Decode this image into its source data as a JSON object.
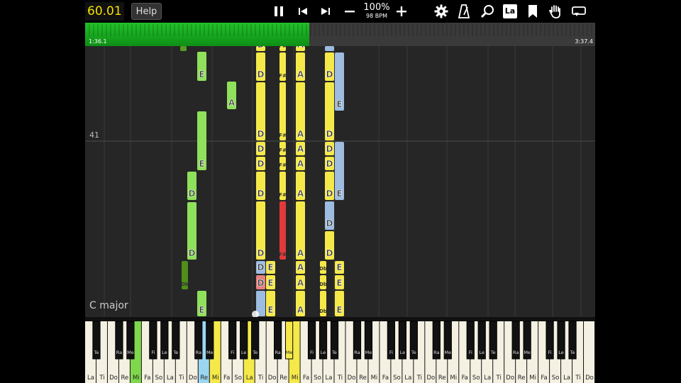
{
  "toolbar": {
    "fps": "60.01",
    "help_label": "Help",
    "tempo_percent": "100%",
    "tempo_bpm": "98 BPM",
    "icons": [
      "pause-icon",
      "rewind-icon",
      "skip-forward-icon",
      "minus-icon",
      "plus-icon",
      "gear-icon",
      "metronome-icon",
      "magnifier-icon",
      "solfege-icon",
      "bookmark-icon",
      "hand-icon",
      "loop-icon"
    ],
    "solfege_label": "La"
  },
  "timeline": {
    "elapsed": "1:36.1",
    "total": "3:37.4",
    "progress": 0.44
  },
  "roll": {
    "measure_number": "41",
    "key_signature": "C major"
  },
  "keyboard": {
    "white_labels": [
      "La",
      "Ti",
      "Do",
      "Re",
      "Mi",
      "Fa",
      "So",
      "La",
      "Ti",
      "Do",
      "Re",
      "Mi",
      "Fa",
      "So",
      "La",
      "Ti",
      "Do",
      "Re",
      "Mi",
      "Fa",
      "So",
      "La",
      "Ti",
      "Do",
      "Re",
      "Mi",
      "Fa",
      "So",
      "La",
      "Ti",
      "Do",
      "Re",
      "Mi",
      "Fa",
      "So",
      "La",
      "Ti",
      "Do",
      "Re",
      "Mi",
      "Fa",
      "So",
      "La",
      "Ti",
      "Do"
    ],
    "black_labels": [
      "Te",
      "Ra",
      "Me",
      "Fi",
      "Le",
      "Te",
      "Ra",
      "Me",
      "Fi",
      "Le",
      "Te",
      "Ra",
      "Me",
      "Fi",
      "Le",
      "Te",
      "Ra",
      "Me",
      "Fi",
      "Le",
      "Te",
      "Ra",
      "Me",
      "Fi",
      "Le",
      "Te",
      "Ra",
      "Me",
      "Fi",
      "Le",
      "Te"
    ],
    "highlighted_white": [
      {
        "index": 10,
        "color": "#9ad6f0"
      },
      {
        "index": 11,
        "color": "#f5e94a"
      },
      {
        "index": 14,
        "color": "#f5e94a"
      },
      {
        "index": 4,
        "color": "#7fd84b"
      },
      {
        "index": 18,
        "color": "#f5e94a"
      }
    ],
    "highlighted_black": [
      {
        "index": 12,
        "color": "#f5e94a"
      }
    ]
  },
  "notes": [
    {
      "label": "",
      "color": "#5a9a22",
      "lane": 134,
      "t0": 0,
      "t1": 8,
      "w": 9
    },
    {
      "label": "E",
      "color": "#8fe05a",
      "lane": 158,
      "t0": 8,
      "t1": 50,
      "w": 13
    },
    {
      "label": "A",
      "color": "#8fe05a",
      "lane": 200,
      "t0": 50,
      "t1": 90,
      "w": 13
    },
    {
      "label": "E",
      "color": "#8fe05a",
      "lane": 158,
      "t0": 92,
      "t1": 176,
      "w": 13
    },
    {
      "label": "D",
      "color": "#8fe05a",
      "lane": 144,
      "t0": 177,
      "t1": 218,
      "w": 13
    },
    {
      "label": "D",
      "color": "#8fe05a",
      "lane": 144,
      "t0": 220,
      "t1": 302,
      "w": 13
    },
    {
      "label": "Db",
      "color": "#4f8f1a",
      "lane": 136,
      "t0": 303,
      "t1": 344,
      "w": 9
    },
    {
      "label": "E",
      "color": "#8fe05a",
      "lane": 158,
      "t0": 345,
      "t1": 382,
      "w": 13
    },
    {
      "label": "D",
      "color": "#f5e94a",
      "lane": 241,
      "t0": 0,
      "t1": 8,
      "w": 13
    },
    {
      "label": "D",
      "color": "#f5e94a",
      "lane": 241,
      "t0": 9,
      "t1": 50,
      "w": 13
    },
    {
      "label": "D",
      "color": "#f5e94a",
      "lane": 241,
      "t0": 51,
      "t1": 134,
      "w": 13
    },
    {
      "label": "D",
      "color": "#f5e94a",
      "lane": 241,
      "t0": 135,
      "t1": 155,
      "w": 13
    },
    {
      "label": "D",
      "color": "#f5e94a",
      "lane": 241,
      "t0": 156,
      "t1": 176,
      "w": 13
    },
    {
      "label": "D",
      "color": "#f5e94a",
      "lane": 241,
      "t0": 177,
      "t1": 218,
      "w": 13
    },
    {
      "label": "D",
      "color": "#f5e94a",
      "lane": 241,
      "t0": 219,
      "t1": 302,
      "w": 13
    },
    {
      "label": "F#",
      "color": "#f5e94a",
      "lane": 274,
      "t0": 0,
      "t1": 8,
      "w": 9
    },
    {
      "label": "F#",
      "color": "#f5e94a",
      "lane": 274,
      "t0": 9,
      "t1": 50,
      "w": 9
    },
    {
      "label": "F#",
      "color": "#f5e94a",
      "lane": 274,
      "t0": 51,
      "t1": 134,
      "w": 9
    },
    {
      "label": "F#",
      "color": "#f5e94a",
      "lane": 274,
      "t0": 135,
      "t1": 155,
      "w": 9
    },
    {
      "label": "F#",
      "color": "#f5e94a",
      "lane": 274,
      "t0": 156,
      "t1": 176,
      "w": 9
    },
    {
      "label": "F#",
      "color": "#f5e94a",
      "lane": 274,
      "t0": 177,
      "t1": 218,
      "w": 9
    },
    {
      "label": "F#",
      "color": "#e23a3a",
      "lane": 274,
      "t0": 219,
      "t1": 302,
      "w": 9
    },
    {
      "label": "A",
      "color": "#f5e94a",
      "lane": 297,
      "t0": 0,
      "t1": 8,
      "w": 13
    },
    {
      "label": "A",
      "color": "#f5e94a",
      "lane": 297,
      "t0": 9,
      "t1": 50,
      "w": 13
    },
    {
      "label": "A",
      "color": "#f5e94a",
      "lane": 297,
      "t0": 51,
      "t1": 134,
      "w": 13
    },
    {
      "label": "A",
      "color": "#f5e94a",
      "lane": 297,
      "t0": 135,
      "t1": 155,
      "w": 13
    },
    {
      "label": "A",
      "color": "#f5e94a",
      "lane": 297,
      "t0": 156,
      "t1": 176,
      "w": 13
    },
    {
      "label": "A",
      "color": "#f5e94a",
      "lane": 297,
      "t0": 177,
      "t1": 218,
      "w": 13
    },
    {
      "label": "A",
      "color": "#f5e94a",
      "lane": 297,
      "t0": 219,
      "t1": 302,
      "w": 13
    },
    {
      "label": "A",
      "color": "#f5e94a",
      "lane": 297,
      "t0": 303,
      "t1": 322,
      "w": 13
    },
    {
      "label": "A",
      "color": "#f5e94a",
      "lane": 297,
      "t0": 323,
      "t1": 344,
      "w": 13
    },
    {
      "label": "A",
      "color": "#f5e94a",
      "lane": 297,
      "t0": 345,
      "t1": 382,
      "w": 13
    },
    {
      "label": "",
      "color": "#9dbce0",
      "lane": 338,
      "t0": 0,
      "t1": 8,
      "w": 13
    },
    {
      "label": "D",
      "color": "#f5e94a",
      "lane": 338,
      "t0": 9,
      "t1": 50,
      "w": 13
    },
    {
      "label": "D",
      "color": "#f5e94a",
      "lane": 338,
      "t0": 51,
      "t1": 134,
      "w": 13
    },
    {
      "label": "D",
      "color": "#f5e94a",
      "lane": 338,
      "t0": 135,
      "t1": 155,
      "w": 13
    },
    {
      "label": "D",
      "color": "#f5e94a",
      "lane": 338,
      "t0": 156,
      "t1": 176,
      "w": 13
    },
    {
      "label": "D",
      "color": "#f5e94a",
      "lane": 338,
      "t0": 177,
      "t1": 218,
      "w": 13
    },
    {
      "label": "D",
      "color": "#9dbce0",
      "lane": 338,
      "t0": 219,
      "t1": 260,
      "w": 13
    },
    {
      "label": "D",
      "color": "#f5e94a",
      "lane": 338,
      "t0": 261,
      "t1": 302,
      "w": 13
    },
    {
      "label": "E",
      "color": "#9dbce0",
      "lane": 352,
      "t0": 9,
      "t1": 92,
      "w": 13
    },
    {
      "label": "E",
      "color": "#9dbce0",
      "lane": 352,
      "t0": 135,
      "t1": 218,
      "w": 13
    },
    {
      "label": "D",
      "color": "#9dbce0",
      "lane": 241,
      "t0": 303,
      "t1": 322,
      "w": 13
    },
    {
      "label": "D",
      "color": "#e88080",
      "lane": 241,
      "t0": 323,
      "t1": 344,
      "w": 13
    },
    {
      "label": "",
      "color": "#9dbce0",
      "lane": 241,
      "t0": 345,
      "t1": 382,
      "w": 13
    },
    {
      "label": "E",
      "color": "#f5e94a",
      "lane": 255,
      "t0": 303,
      "t1": 322,
      "w": 13
    },
    {
      "label": "E",
      "color": "#f5e94a",
      "lane": 255,
      "t0": 323,
      "t1": 344,
      "w": 13
    },
    {
      "label": "E",
      "color": "#f5e94a",
      "lane": 255,
      "t0": 345,
      "t1": 382,
      "w": 13
    },
    {
      "label": "Db",
      "color": "#f5e94a",
      "lane": 331,
      "t0": 303,
      "t1": 322,
      "w": 9
    },
    {
      "label": "Db",
      "color": "#f5e94a",
      "lane": 331,
      "t0": 323,
      "t1": 344,
      "w": 9
    },
    {
      "label": "Db",
      "color": "#f5e94a",
      "lane": 331,
      "t0": 345,
      "t1": 382,
      "w": 9
    },
    {
      "label": "E",
      "color": "#f5e94a",
      "lane": 352,
      "t0": 303,
      "t1": 322,
      "w": 13
    },
    {
      "label": "E",
      "color": "#f5e94a",
      "lane": 352,
      "t0": 323,
      "t1": 344,
      "w": 13
    },
    {
      "label": "E",
      "color": "#f5e94a",
      "lane": 352,
      "t0": 345,
      "t1": 382,
      "w": 13
    }
  ],
  "colors": {
    "green": "#8fe05a",
    "yellow": "#f5e94a",
    "blue": "#9dbce0",
    "red": "#e23a3a",
    "progress": "#22c12a",
    "fps": "#f3e000"
  }
}
